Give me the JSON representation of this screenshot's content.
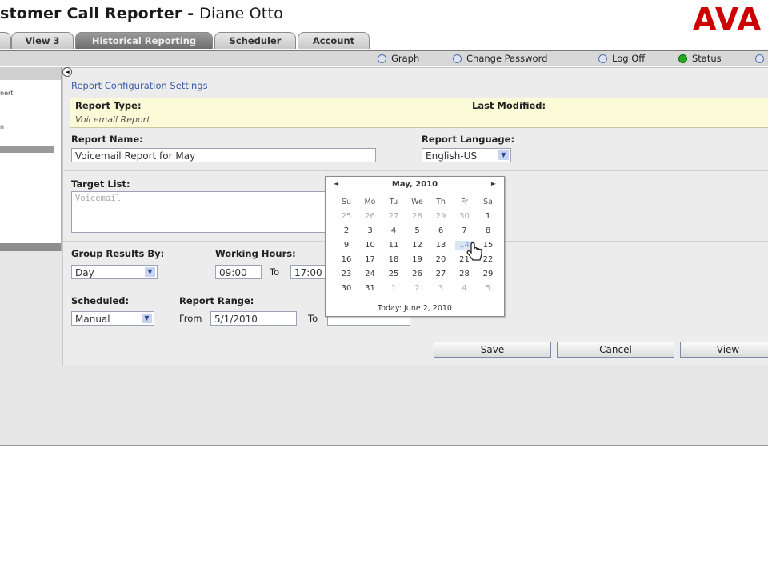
{
  "header": {
    "app_title": "stomer Call Reporter",
    "separator": " - ",
    "user_name": "Diane Otto",
    "logo_text": "AVA"
  },
  "tabs": [
    {
      "label": ""
    },
    {
      "label": "View 3"
    },
    {
      "label": "Historical Reporting"
    },
    {
      "label": "Scheduler"
    },
    {
      "label": "Account"
    }
  ],
  "toolbar": {
    "graph": "Graph",
    "change_password": "Change Password",
    "log_off": "Log Off",
    "status": "Status"
  },
  "left_panel": {
    "items": [
      "nert",
      "n"
    ]
  },
  "form": {
    "section_title": "Report Configuration Settings",
    "report_type_label": "Report Type:",
    "report_type_value": "Voicemail Report",
    "last_modified_label": "Last Modified:",
    "report_name_label": "Report Name:",
    "report_name_value": "Voicemail Report for May",
    "report_language_label": "Report Language:",
    "report_language_value": "English-US",
    "target_list_label": "Target List:",
    "target_list_value": "Voicemail",
    "group_results_label": "Group Results By:",
    "group_results_value": "Day",
    "working_hours_label": "Working Hours:",
    "working_hours_from": "09:00",
    "to_label": "To",
    "working_hours_to": "17:00",
    "scheduled_label": "Scheduled:",
    "scheduled_value": "Manual",
    "report_range_label": "Report Range:",
    "from_label": "From",
    "range_from": "5/1/2010",
    "range_to_label": "To",
    "range_to": ""
  },
  "buttons": {
    "save": "Save",
    "cancel": "Cancel",
    "view": "View"
  },
  "calendar": {
    "month_label": "May, 2010",
    "prev": "◄",
    "next": "►",
    "weekdays": [
      "Su",
      "Mo",
      "Tu",
      "We",
      "Th",
      "Fr",
      "Sa"
    ],
    "weeks": [
      [
        "25",
        "26",
        "27",
        "28",
        "29",
        "30",
        "1"
      ],
      [
        "2",
        "3",
        "4",
        "5",
        "6",
        "7",
        "8"
      ],
      [
        "9",
        "10",
        "11",
        "12",
        "13",
        "14",
        "15"
      ],
      [
        "16",
        "17",
        "18",
        "19",
        "20",
        "21",
        "22"
      ],
      [
        "23",
        "24",
        "25",
        "26",
        "27",
        "28",
        "29"
      ],
      [
        "30",
        "31",
        "1",
        "2",
        "3",
        "4",
        "5"
      ]
    ],
    "other_month": [
      [
        true,
        true,
        true,
        true,
        true,
        true,
        false
      ],
      [
        false,
        false,
        false,
        false,
        false,
        false,
        false
      ],
      [
        false,
        false,
        false,
        false,
        false,
        false,
        false
      ],
      [
        false,
        false,
        false,
        false,
        false,
        false,
        false
      ],
      [
        false,
        false,
        false,
        false,
        false,
        false,
        false
      ],
      [
        false,
        false,
        true,
        true,
        true,
        true,
        true
      ]
    ],
    "selected": "14",
    "today_text": "Today: June 2, 2010"
  }
}
